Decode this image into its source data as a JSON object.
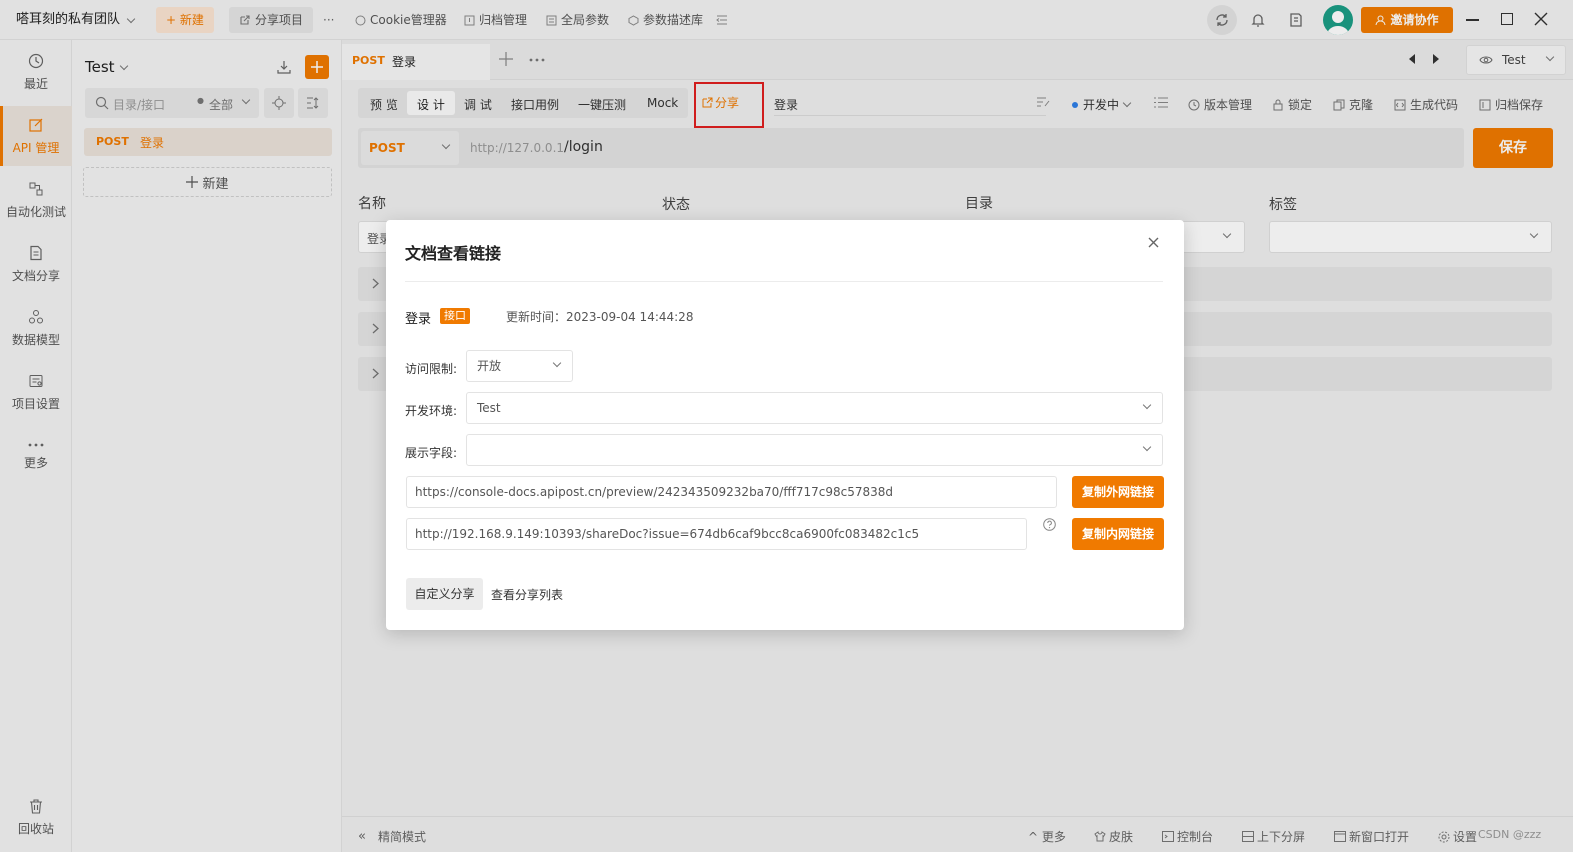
{
  "topbar": {
    "team_name": "嗒耳刻的私有团队",
    "new_label": "+ 新建",
    "share_project": "分享项目",
    "more": "···",
    "cookie": "Cookie管理器",
    "archive": "归档管理",
    "global_params": "全局参数",
    "param_desc": "参数描述库",
    "invite": "邀请协作"
  },
  "leftnav": [
    {
      "label": "最近",
      "icon": "clock-icon"
    },
    {
      "label": "API 管理",
      "icon": "edit-icon"
    },
    {
      "label": "自动化测试",
      "icon": "flow-icon"
    },
    {
      "label": "文档分享",
      "icon": "doc-icon"
    },
    {
      "label": "数据模型",
      "icon": "model-icon"
    },
    {
      "label": "项目设置",
      "icon": "settings-icon"
    },
    {
      "label": "更多",
      "icon": "more-icon"
    }
  ],
  "leftnav_bottom": "回收站",
  "tree": {
    "project": "Test",
    "search_placeholder": "目录/接口",
    "filter": "全部",
    "item_method": "POST",
    "item_name": "登录",
    "new_label": "新建"
  },
  "tab": {
    "method": "POST",
    "name": "登录",
    "env": "Test"
  },
  "subtabs": [
    "预 览",
    "设 计",
    "调 试",
    "接口用例",
    "一键压测",
    "Mock"
  ],
  "share_tab": "分享",
  "doc_name": "登录",
  "toolbar": {
    "env": "开发中",
    "version": "版本管理",
    "lock": "锁定",
    "clone": "克隆",
    "codegen": "生成代码",
    "archive_save": "归档保存"
  },
  "request": {
    "method": "POST",
    "base_url": "http://127.0.0.1",
    "path": "/login",
    "save": "保存"
  },
  "fields": {
    "name": "名称",
    "status": "状态",
    "dir": "目录",
    "tags": "标签",
    "name_value": "登录"
  },
  "modal": {
    "title": "文档查看链接",
    "doc_name": "登录",
    "badge": "接口",
    "updated": "更新时间：2023-09-04 14:44:28",
    "access_label": "访问限制:",
    "access_value": "开放",
    "env_label": "开发环境:",
    "env_value": "Test",
    "fields_label": "展示字段:",
    "fields_value": "",
    "external_link": "https://console-docs.apipost.cn/preview/242343509232ba70/fff717c98c57838d",
    "copy_external": "复制外网链接",
    "internal_link": "http://192.168.9.149:10393/shareDoc?issue=674db6caf9bcc8ca6900fc083482c1c5",
    "copy_internal": "复制内网链接",
    "custom_share": "自定义分享",
    "share_list": "查看分享列表"
  },
  "bottombar": {
    "simple_mode": "精简模式",
    "more": "更多",
    "skin": "皮肤",
    "console": "控制台",
    "split": "上下分屏",
    "new_window": "新窗口打开",
    "settings": "设置",
    "watermark": "CSDN @zzz"
  },
  "colors": {
    "accent": "#f07a00",
    "highlight_border": "#e02020"
  }
}
